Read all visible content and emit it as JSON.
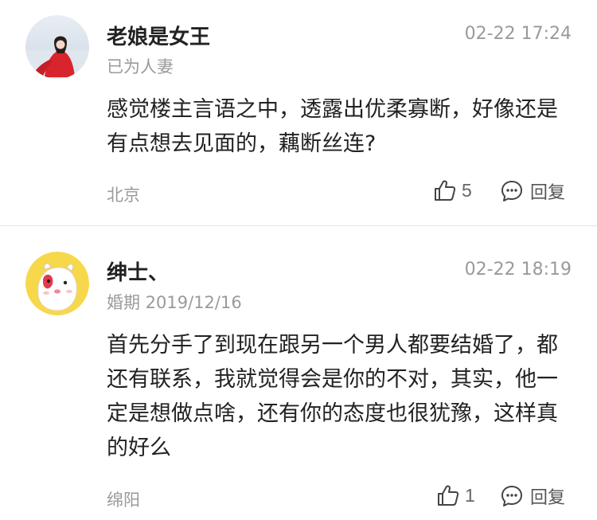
{
  "comments": [
    {
      "username": "老娘是女王",
      "timestamp": "02-22 17:24",
      "subtitle": "已为人妻",
      "body": "感觉楼主言语之中，透露出优柔寡断，好像还是有点想去见面的，藕断丝连?",
      "location": "北京",
      "likes": "5",
      "reply_label": "回复",
      "avatar": "woman-in-red-photo"
    },
    {
      "username": "绅士、",
      "timestamp": "02-22 18:19",
      "subtitle": "婚期 2019/12/16",
      "body": "首先分手了到现在跟另一个男人都要结婚了，都还有联系，我就觉得会是你的不对，其实，他一定是想做点啥，还有你的态度也很犹豫，这样真的好么",
      "location": "绵阳",
      "likes": "1",
      "reply_label": "回复",
      "avatar": "cartoon-animal-yellow"
    }
  ],
  "icons": {
    "like": "thumbs-up-icon",
    "reply": "speech-bubble-icon"
  },
  "colors": {
    "primary_text": "#222222",
    "secondary_text": "#9a9a9a",
    "divider": "#e6e6e6",
    "avatar_bg_yellow": "#f6d84a"
  }
}
